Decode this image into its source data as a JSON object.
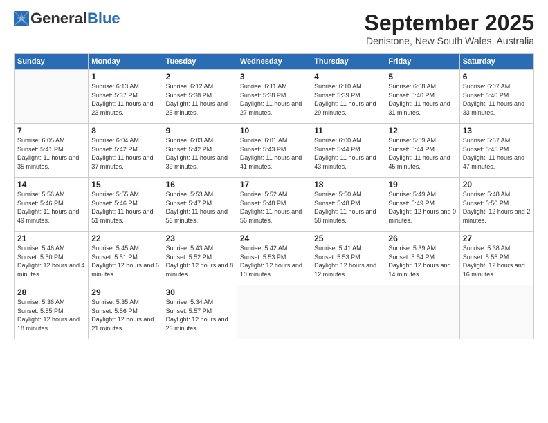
{
  "header": {
    "logo_general": "General",
    "logo_blue": "Blue",
    "month_title": "September 2025",
    "location": "Denistone, New South Wales, Australia"
  },
  "weekdays": [
    "Sunday",
    "Monday",
    "Tuesday",
    "Wednesday",
    "Thursday",
    "Friday",
    "Saturday"
  ],
  "weeks": [
    [
      {
        "day": "",
        "sunrise": "",
        "sunset": "",
        "daylight": ""
      },
      {
        "day": "1",
        "sunrise": "Sunrise: 6:13 AM",
        "sunset": "Sunset: 5:37 PM",
        "daylight": "Daylight: 11 hours and 23 minutes."
      },
      {
        "day": "2",
        "sunrise": "Sunrise: 6:12 AM",
        "sunset": "Sunset: 5:38 PM",
        "daylight": "Daylight: 11 hours and 25 minutes."
      },
      {
        "day": "3",
        "sunrise": "Sunrise: 6:11 AM",
        "sunset": "Sunset: 5:38 PM",
        "daylight": "Daylight: 11 hours and 27 minutes."
      },
      {
        "day": "4",
        "sunrise": "Sunrise: 6:10 AM",
        "sunset": "Sunset: 5:39 PM",
        "daylight": "Daylight: 11 hours and 29 minutes."
      },
      {
        "day": "5",
        "sunrise": "Sunrise: 6:08 AM",
        "sunset": "Sunset: 5:40 PM",
        "daylight": "Daylight: 11 hours and 31 minutes."
      },
      {
        "day": "6",
        "sunrise": "Sunrise: 6:07 AM",
        "sunset": "Sunset: 5:40 PM",
        "daylight": "Daylight: 11 hours and 33 minutes."
      }
    ],
    [
      {
        "day": "7",
        "sunrise": "Sunrise: 6:05 AM",
        "sunset": "Sunset: 5:41 PM",
        "daylight": "Daylight: 11 hours and 35 minutes."
      },
      {
        "day": "8",
        "sunrise": "Sunrise: 6:04 AM",
        "sunset": "Sunset: 5:42 PM",
        "daylight": "Daylight: 11 hours and 37 minutes."
      },
      {
        "day": "9",
        "sunrise": "Sunrise: 6:03 AM",
        "sunset": "Sunset: 5:42 PM",
        "daylight": "Daylight: 11 hours and 39 minutes."
      },
      {
        "day": "10",
        "sunrise": "Sunrise: 6:01 AM",
        "sunset": "Sunset: 5:43 PM",
        "daylight": "Daylight: 11 hours and 41 minutes."
      },
      {
        "day": "11",
        "sunrise": "Sunrise: 6:00 AM",
        "sunset": "Sunset: 5:44 PM",
        "daylight": "Daylight: 11 hours and 43 minutes."
      },
      {
        "day": "12",
        "sunrise": "Sunrise: 5:59 AM",
        "sunset": "Sunset: 5:44 PM",
        "daylight": "Daylight: 11 hours and 45 minutes."
      },
      {
        "day": "13",
        "sunrise": "Sunrise: 5:57 AM",
        "sunset": "Sunset: 5:45 PM",
        "daylight": "Daylight: 11 hours and 47 minutes."
      }
    ],
    [
      {
        "day": "14",
        "sunrise": "Sunrise: 5:56 AM",
        "sunset": "Sunset: 5:46 PM",
        "daylight": "Daylight: 11 hours and 49 minutes."
      },
      {
        "day": "15",
        "sunrise": "Sunrise: 5:55 AM",
        "sunset": "Sunset: 5:46 PM",
        "daylight": "Daylight: 11 hours and 51 minutes."
      },
      {
        "day": "16",
        "sunrise": "Sunrise: 5:53 AM",
        "sunset": "Sunset: 5:47 PM",
        "daylight": "Daylight: 11 hours and 53 minutes."
      },
      {
        "day": "17",
        "sunrise": "Sunrise: 5:52 AM",
        "sunset": "Sunset: 5:48 PM",
        "daylight": "Daylight: 11 hours and 56 minutes."
      },
      {
        "day": "18",
        "sunrise": "Sunrise: 5:50 AM",
        "sunset": "Sunset: 5:48 PM",
        "daylight": "Daylight: 11 hours and 58 minutes."
      },
      {
        "day": "19",
        "sunrise": "Sunrise: 5:49 AM",
        "sunset": "Sunset: 5:49 PM",
        "daylight": "Daylight: 12 hours and 0 minutes."
      },
      {
        "day": "20",
        "sunrise": "Sunrise: 5:48 AM",
        "sunset": "Sunset: 5:50 PM",
        "daylight": "Daylight: 12 hours and 2 minutes."
      }
    ],
    [
      {
        "day": "21",
        "sunrise": "Sunrise: 5:46 AM",
        "sunset": "Sunset: 5:50 PM",
        "daylight": "Daylight: 12 hours and 4 minutes."
      },
      {
        "day": "22",
        "sunrise": "Sunrise: 5:45 AM",
        "sunset": "Sunset: 5:51 PM",
        "daylight": "Daylight: 12 hours and 6 minutes."
      },
      {
        "day": "23",
        "sunrise": "Sunrise: 5:43 AM",
        "sunset": "Sunset: 5:52 PM",
        "daylight": "Daylight: 12 hours and 8 minutes."
      },
      {
        "day": "24",
        "sunrise": "Sunrise: 5:42 AM",
        "sunset": "Sunset: 5:53 PM",
        "daylight": "Daylight: 12 hours and 10 minutes."
      },
      {
        "day": "25",
        "sunrise": "Sunrise: 5:41 AM",
        "sunset": "Sunset: 5:53 PM",
        "daylight": "Daylight: 12 hours and 12 minutes."
      },
      {
        "day": "26",
        "sunrise": "Sunrise: 5:39 AM",
        "sunset": "Sunset: 5:54 PM",
        "daylight": "Daylight: 12 hours and 14 minutes."
      },
      {
        "day": "27",
        "sunrise": "Sunrise: 5:38 AM",
        "sunset": "Sunset: 5:55 PM",
        "daylight": "Daylight: 12 hours and 16 minutes."
      }
    ],
    [
      {
        "day": "28",
        "sunrise": "Sunrise: 5:36 AM",
        "sunset": "Sunset: 5:55 PM",
        "daylight": "Daylight: 12 hours and 18 minutes."
      },
      {
        "day": "29",
        "sunrise": "Sunrise: 5:35 AM",
        "sunset": "Sunset: 5:56 PM",
        "daylight": "Daylight: 12 hours and 21 minutes."
      },
      {
        "day": "30",
        "sunrise": "Sunrise: 5:34 AM",
        "sunset": "Sunset: 5:57 PM",
        "daylight": "Daylight: 12 hours and 23 minutes."
      },
      {
        "day": "",
        "sunrise": "",
        "sunset": "",
        "daylight": ""
      },
      {
        "day": "",
        "sunrise": "",
        "sunset": "",
        "daylight": ""
      },
      {
        "day": "",
        "sunrise": "",
        "sunset": "",
        "daylight": ""
      },
      {
        "day": "",
        "sunrise": "",
        "sunset": "",
        "daylight": ""
      }
    ]
  ]
}
